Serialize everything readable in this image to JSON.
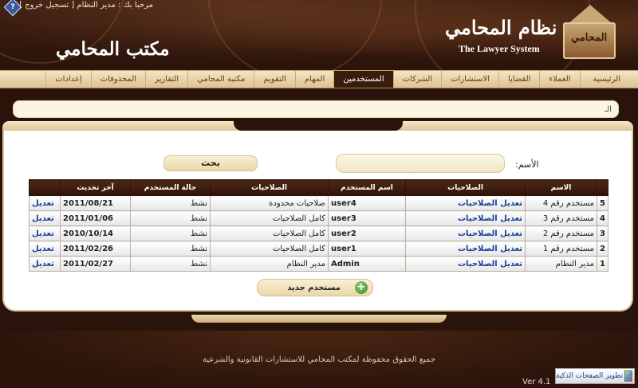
{
  "header": {
    "welcome_prefix": "مرحبا بك : مدير النظام [",
    "logout_label": "تسجيل خروج",
    "welcome_suffix": "]",
    "help_icon_glyph": "?",
    "office_title": "مكتب المحامي",
    "system_title_ar": "نظام المحامي",
    "system_title_en": "The Lawyer System",
    "logo_text": "المحامي"
  },
  "nav": {
    "items": [
      {
        "label": "الرئيسية",
        "active": false
      },
      {
        "label": "العملاء",
        "active": false
      },
      {
        "label": "القضايا",
        "active": false
      },
      {
        "label": "الاستشارات",
        "active": false
      },
      {
        "label": "الشركات",
        "active": false
      },
      {
        "label": "المستخدمين",
        "active": true
      },
      {
        "label": "المهام",
        "active": false
      },
      {
        "label": "التقويم",
        "active": false
      },
      {
        "label": "مكتبة المحامي",
        "active": false
      },
      {
        "label": "التقارير",
        "active": false
      },
      {
        "label": "المحذوفات",
        "active": false
      },
      {
        "label": "إعدادات",
        "active": false
      }
    ]
  },
  "breadcrumb": "الـ",
  "search": {
    "name_label": "الأسم:",
    "name_value": "",
    "button_label": "بحث"
  },
  "table": {
    "headers": {
      "num": "",
      "name": "الاسم",
      "permissions_link": "الصلاحيات",
      "username": "اسم المستخدم",
      "permissions": "الصلاحيات",
      "status": "حالة المستخدم",
      "last_update": "آخر تحديث",
      "edit": ""
    },
    "rows": [
      {
        "num": "5",
        "name": "مستخدم رقم 4",
        "perm_link": "تعديل الصلاحيات",
        "username": "user4",
        "permissions": "صلاحيات محدودة",
        "status": "نشط",
        "last_update": "2011/08/21",
        "edit": "تعديل"
      },
      {
        "num": "4",
        "name": "مستخدم رقم 3",
        "perm_link": "تعديل الصلاحيات",
        "username": "user3",
        "permissions": "كامل الصلاحيات",
        "status": "نشط",
        "last_update": "2011/01/06",
        "edit": "تعديل"
      },
      {
        "num": "3",
        "name": "مستخدم رقم 2",
        "perm_link": "تعديل الصلاحيات",
        "username": "user2",
        "permissions": "كامل الصلاحيات",
        "status": "نشط",
        "last_update": "2010/10/14",
        "edit": "تعديل"
      },
      {
        "num": "2",
        "name": "مستخدم رقم 1",
        "perm_link": "تعديل الصلاحيات",
        "username": "user1",
        "permissions": "كامل الصلاحيات",
        "status": "نشط",
        "last_update": "2011/02/26",
        "edit": "تعديل"
      },
      {
        "num": "1",
        "name": "مدير النظام",
        "perm_link": "تعديل الصلاحيات",
        "username": "Admin",
        "permissions": "مدير النظام",
        "status": "نشط",
        "last_update": "2011/02/27",
        "edit": "تعديل"
      }
    ]
  },
  "new_user": {
    "label": "مستخدم جديد",
    "icon_glyph": "+"
  },
  "footer": {
    "copyright": "جميع الحقوق محفوظة لمكتب المحامي للاستشارات القانونية والشرعية",
    "version": "Ver 4.1",
    "smart_pages_label": "تطوير الصفحات الذكية"
  },
  "colors": {
    "brand_dark": "#2a130a",
    "nav_active": "#3a1c0d",
    "link": "#1a3f9a",
    "panel_border": "#d9c496"
  }
}
